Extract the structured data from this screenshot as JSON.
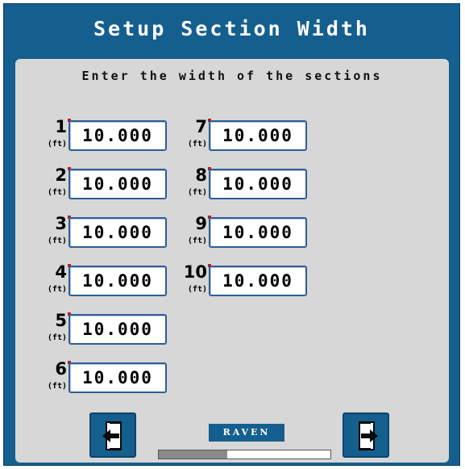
{
  "title": "Setup Section Width",
  "instruction": "Enter the width of the sections",
  "unit": "(ft)",
  "sections": [
    {
      "number": "1",
      "value": "10.000"
    },
    {
      "number": "2",
      "value": "10.000"
    },
    {
      "number": "3",
      "value": "10.000"
    },
    {
      "number": "4",
      "value": "10.000"
    },
    {
      "number": "5",
      "value": "10.000"
    },
    {
      "number": "6",
      "value": "10.000"
    },
    {
      "number": "7",
      "value": "10.000"
    },
    {
      "number": "8",
      "value": "10.000"
    },
    {
      "number": "9",
      "value": "10.000"
    },
    {
      "number": "10",
      "value": "10.000"
    }
  ],
  "brand": "RAVEN",
  "progress_fraction": 0.4,
  "icons": {
    "back": "back-arrow-icon",
    "next": "next-arrow-icon"
  },
  "colors": {
    "header": "#155f8f",
    "panel": "#d7d7d7",
    "field_border": "#2d5d9a",
    "required_marker": "#c41a1a"
  }
}
